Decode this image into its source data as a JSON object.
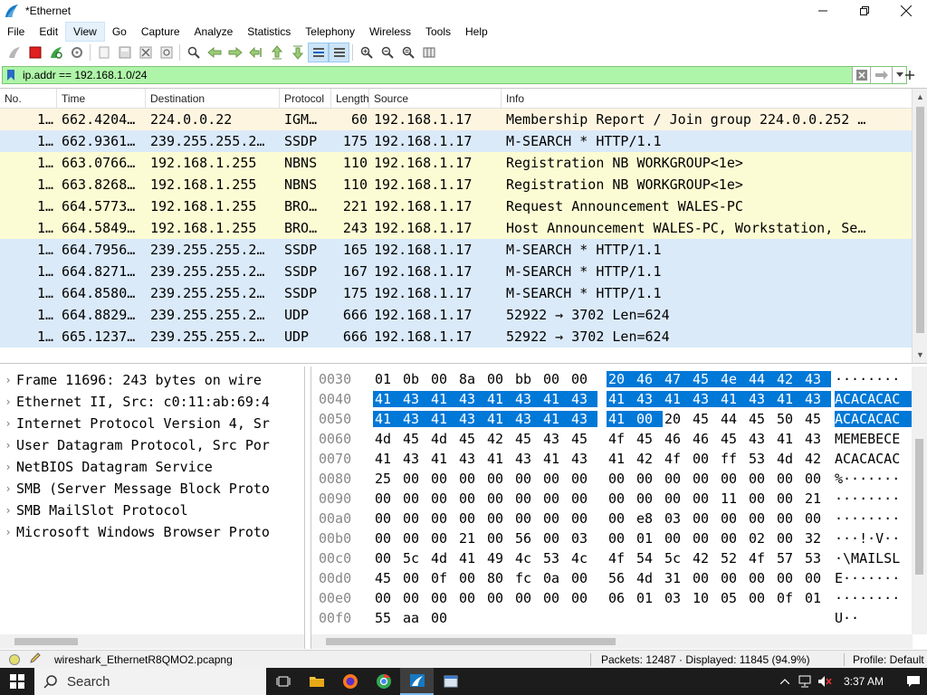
{
  "window": {
    "title": "*Ethernet"
  },
  "menu": [
    "File",
    "Edit",
    "View",
    "Go",
    "Capture",
    "Analyze",
    "Statistics",
    "Telephony",
    "Wireless",
    "Tools",
    "Help"
  ],
  "filter": {
    "value": "ip.addr == 192.168.1.0/24"
  },
  "packet_list": {
    "columns": [
      "No.",
      "Time",
      "Destination",
      "Protocol",
      "Length",
      "Source",
      "Info"
    ],
    "rows": [
      {
        "no": "1…",
        "time": "662.4204…",
        "dst": "224.0.0.22",
        "proto": "IGM…",
        "len": "60",
        "src": "192.168.1.17",
        "info": "Membership Report / Join group 224.0.0.252 …",
        "bg": "#fdf5e0"
      },
      {
        "no": "1…",
        "time": "662.9361…",
        "dst": "239.255.255.2…",
        "proto": "SSDP",
        "len": "175",
        "src": "192.168.1.17",
        "info": "M-SEARCH * HTTP/1.1",
        "bg": "#dbeaf9"
      },
      {
        "no": "1…",
        "time": "663.0766…",
        "dst": "192.168.1.255",
        "proto": "NBNS",
        "len": "110",
        "src": "192.168.1.17",
        "info": "Registration NB WORKGROUP<1e>",
        "bg": "#fcfcd4"
      },
      {
        "no": "1…",
        "time": "663.8268…",
        "dst": "192.168.1.255",
        "proto": "NBNS",
        "len": "110",
        "src": "192.168.1.17",
        "info": "Registration NB WORKGROUP<1e>",
        "bg": "#fcfcd4"
      },
      {
        "no": "1…",
        "time": "664.5773…",
        "dst": "192.168.1.255",
        "proto": "BRO…",
        "len": "221",
        "src": "192.168.1.17",
        "info": "Request Announcement WALES-PC",
        "bg": "#fcfcd4"
      },
      {
        "no": "1…",
        "time": "664.5849…",
        "dst": "192.168.1.255",
        "proto": "BRO…",
        "len": "243",
        "src": "192.168.1.17",
        "info": "Host Announcement WALES-PC, Workstation, Se…",
        "bg": "#fcfcd4"
      },
      {
        "no": "1…",
        "time": "664.7956…",
        "dst": "239.255.255.2…",
        "proto": "SSDP",
        "len": "165",
        "src": "192.168.1.17",
        "info": "M-SEARCH * HTTP/1.1",
        "bg": "#dbeaf9"
      },
      {
        "no": "1…",
        "time": "664.8271…",
        "dst": "239.255.255.2…",
        "proto": "SSDP",
        "len": "167",
        "src": "192.168.1.17",
        "info": "M-SEARCH * HTTP/1.1",
        "bg": "#dbeaf9"
      },
      {
        "no": "1…",
        "time": "664.8580…",
        "dst": "239.255.255.2…",
        "proto": "SSDP",
        "len": "175",
        "src": "192.168.1.17",
        "info": "M-SEARCH * HTTP/1.1",
        "bg": "#dbeaf9"
      },
      {
        "no": "1…",
        "time": "664.8829…",
        "dst": "239.255.255.2…",
        "proto": "UDP",
        "len": "666",
        "src": "192.168.1.17",
        "info": "52922 → 3702 Len=624",
        "bg": "#dbeaf9"
      },
      {
        "no": "1…",
        "time": "665.1237…",
        "dst": "239.255.255.2…",
        "proto": "UDP",
        "len": "666",
        "src": "192.168.1.17",
        "info": "52922 → 3702 Len=624",
        "bg": "#dbeaf9"
      }
    ]
  },
  "details": [
    "Frame 11696: 243 bytes on wire",
    "Ethernet II, Src: c0:11:ab:69:4",
    "Internet Protocol Version 4, Sr",
    "User Datagram Protocol, Src Por",
    "NetBIOS Datagram Service",
    "SMB (Server Message Block Proto",
    "SMB MailSlot Protocol",
    "Microsoft Windows Browser Proto"
  ],
  "hex": [
    {
      "off": "0030",
      "bytes": [
        "01",
        "0b",
        "00",
        "8a",
        "00",
        "bb",
        "00",
        "00",
        "20",
        "46",
        "47",
        "45",
        "4e",
        "44",
        "42",
        "43"
      ],
      "sel_from": 8,
      "sel_to": 16,
      "ascii": "········",
      "ascii_sel": false
    },
    {
      "off": "0040",
      "bytes": [
        "41",
        "43",
        "41",
        "43",
        "41",
        "43",
        "41",
        "43",
        "41",
        "43",
        "41",
        "43",
        "41",
        "43",
        "41",
        "43"
      ],
      "sel_from": 0,
      "sel_to": 16,
      "ascii": "ACACACAC",
      "ascii_sel": true
    },
    {
      "off": "0050",
      "bytes": [
        "41",
        "43",
        "41",
        "43",
        "41",
        "43",
        "41",
        "43",
        "41",
        "00",
        "20",
        "45",
        "44",
        "45",
        "50",
        "45"
      ],
      "sel_from": 0,
      "sel_to": 10,
      "ascii": "ACACACAC",
      "ascii_sel": true
    },
    {
      "off": "0060",
      "bytes": [
        "4d",
        "45",
        "4d",
        "45",
        "42",
        "45",
        "43",
        "45",
        "4f",
        "45",
        "46",
        "46",
        "45",
        "43",
        "41",
        "43"
      ],
      "sel_from": -1,
      "sel_to": -1,
      "ascii": "MEMEBECE",
      "ascii_sel": false
    },
    {
      "off": "0070",
      "bytes": [
        "41",
        "43",
        "41",
        "43",
        "41",
        "43",
        "41",
        "43",
        "41",
        "42",
        "4f",
        "00",
        "ff",
        "53",
        "4d",
        "42"
      ],
      "sel_from": -1,
      "sel_to": -1,
      "ascii": "ACACACAC",
      "ascii_sel": false
    },
    {
      "off": "0080",
      "bytes": [
        "25",
        "00",
        "00",
        "00",
        "00",
        "00",
        "00",
        "00",
        "00",
        "00",
        "00",
        "00",
        "00",
        "00",
        "00",
        "00"
      ],
      "sel_from": -1,
      "sel_to": -1,
      "ascii": "%·······",
      "ascii_sel": false
    },
    {
      "off": "0090",
      "bytes": [
        "00",
        "00",
        "00",
        "00",
        "00",
        "00",
        "00",
        "00",
        "00",
        "00",
        "00",
        "00",
        "11",
        "00",
        "00",
        "21"
      ],
      "sel_from": -1,
      "sel_to": -1,
      "ascii": "········",
      "ascii_sel": false
    },
    {
      "off": "00a0",
      "bytes": [
        "00",
        "00",
        "00",
        "00",
        "00",
        "00",
        "00",
        "00",
        "00",
        "e8",
        "03",
        "00",
        "00",
        "00",
        "00",
        "00"
      ],
      "sel_from": -1,
      "sel_to": -1,
      "ascii": "········",
      "ascii_sel": false
    },
    {
      "off": "00b0",
      "bytes": [
        "00",
        "00",
        "00",
        "21",
        "00",
        "56",
        "00",
        "03",
        "00",
        "01",
        "00",
        "00",
        "00",
        "02",
        "00",
        "32"
      ],
      "sel_from": -1,
      "sel_to": -1,
      "ascii": "···!·V··",
      "ascii_sel": false
    },
    {
      "off": "00c0",
      "bytes": [
        "00",
        "5c",
        "4d",
        "41",
        "49",
        "4c",
        "53",
        "4c",
        "4f",
        "54",
        "5c",
        "42",
        "52",
        "4f",
        "57",
        "53"
      ],
      "sel_from": -1,
      "sel_to": -1,
      "ascii": "·\\MAILSL",
      "ascii_sel": false
    },
    {
      "off": "00d0",
      "bytes": [
        "45",
        "00",
        "0f",
        "00",
        "80",
        "fc",
        "0a",
        "00",
        "56",
        "4d",
        "31",
        "00",
        "00",
        "00",
        "00",
        "00"
      ],
      "sel_from": -1,
      "sel_to": -1,
      "ascii": "E·······",
      "ascii_sel": false
    },
    {
      "off": "00e0",
      "bytes": [
        "00",
        "00",
        "00",
        "00",
        "00",
        "00",
        "00",
        "00",
        "06",
        "01",
        "03",
        "10",
        "05",
        "00",
        "0f",
        "01"
      ],
      "sel_from": -1,
      "sel_to": -1,
      "ascii": "········",
      "ascii_sel": false
    },
    {
      "off": "00f0",
      "bytes": [
        "55",
        "aa",
        "00"
      ],
      "sel_from": -1,
      "sel_to": -1,
      "ascii": "U··",
      "ascii_sel": false
    }
  ],
  "status": {
    "file": "wireshark_EthernetR8QMO2.pcapng",
    "packets": "Packets: 12487 · Displayed: 11845 (94.9%)",
    "profile": "Profile: Default"
  },
  "taskbar": {
    "search": "Search",
    "time": "3:37 AM"
  },
  "colors": {
    "accent": "#0078d7",
    "filter_bg": "#aff5a9",
    "hover": "#e5f1fb"
  }
}
